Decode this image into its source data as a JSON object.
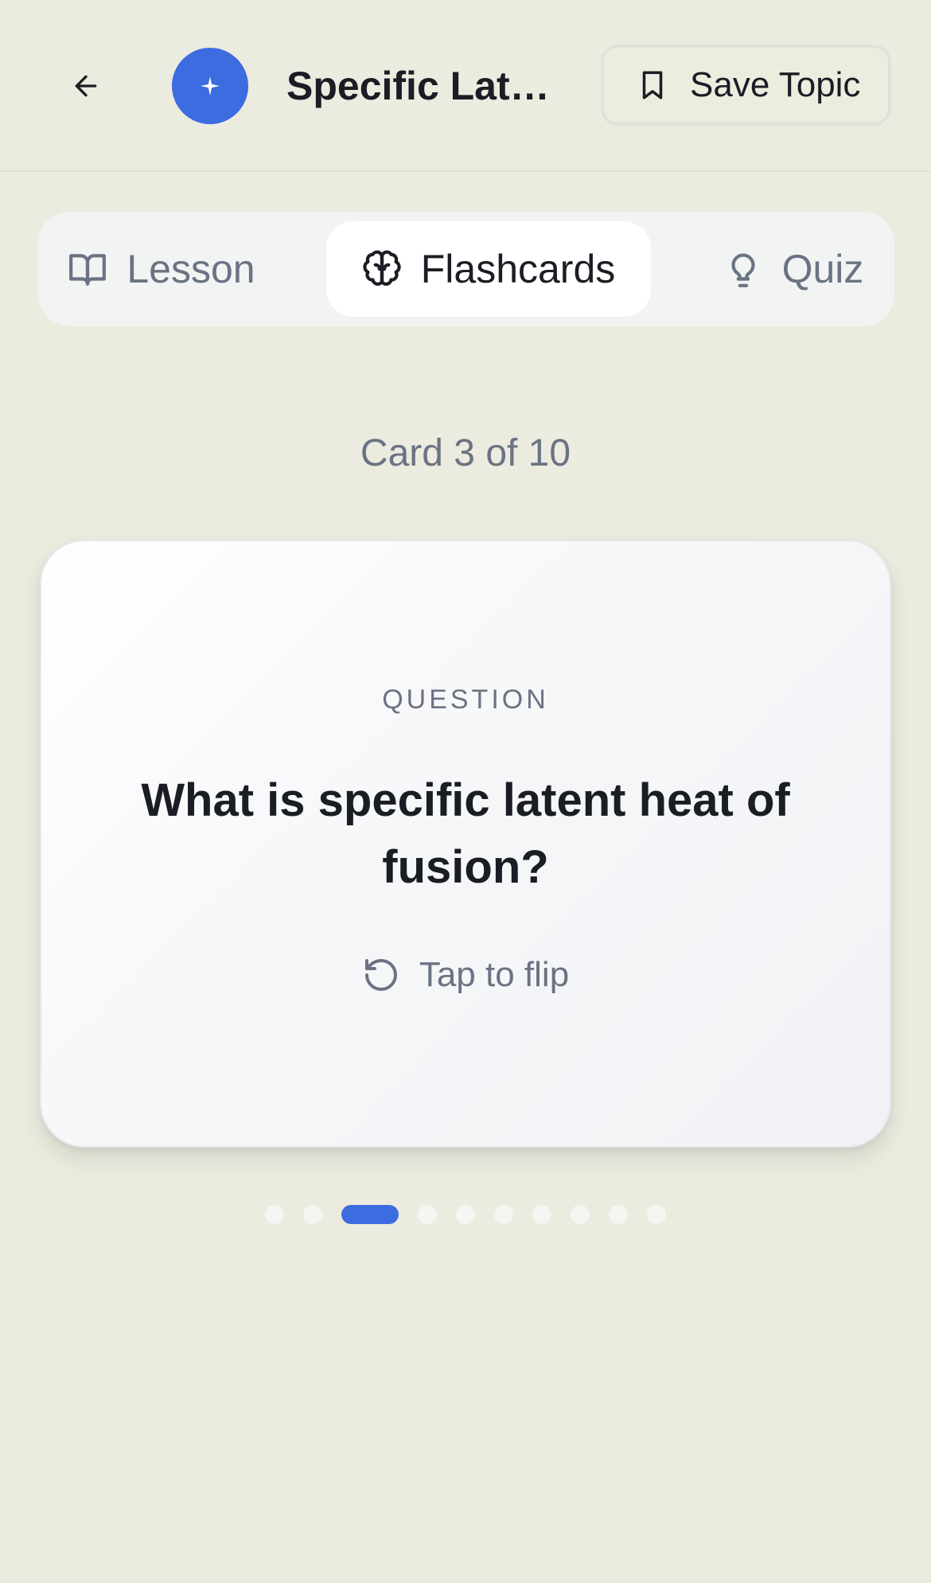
{
  "header": {
    "topic_title": "Specific Latent Heat of Fusion",
    "save_label": "Save Topic"
  },
  "tabs": [
    {
      "label": "Lesson",
      "icon": "book-open-icon",
      "active": false
    },
    {
      "label": "Flashcards",
      "icon": "brain-icon",
      "active": true
    },
    {
      "label": "Quiz",
      "icon": "lightbulb-icon",
      "active": false
    }
  ],
  "flashcards": {
    "counter_text": "Card 3 of 10",
    "current_index": 3,
    "total": 10,
    "side_label": "QUESTION",
    "question": "What is specific latent heat of fusion?",
    "flip_hint": "Tap to flip"
  },
  "colors": {
    "accent": "#3d6be0",
    "background": "#ebebdf",
    "muted_text": "#6a7383",
    "primary_text": "#1a1d24"
  }
}
